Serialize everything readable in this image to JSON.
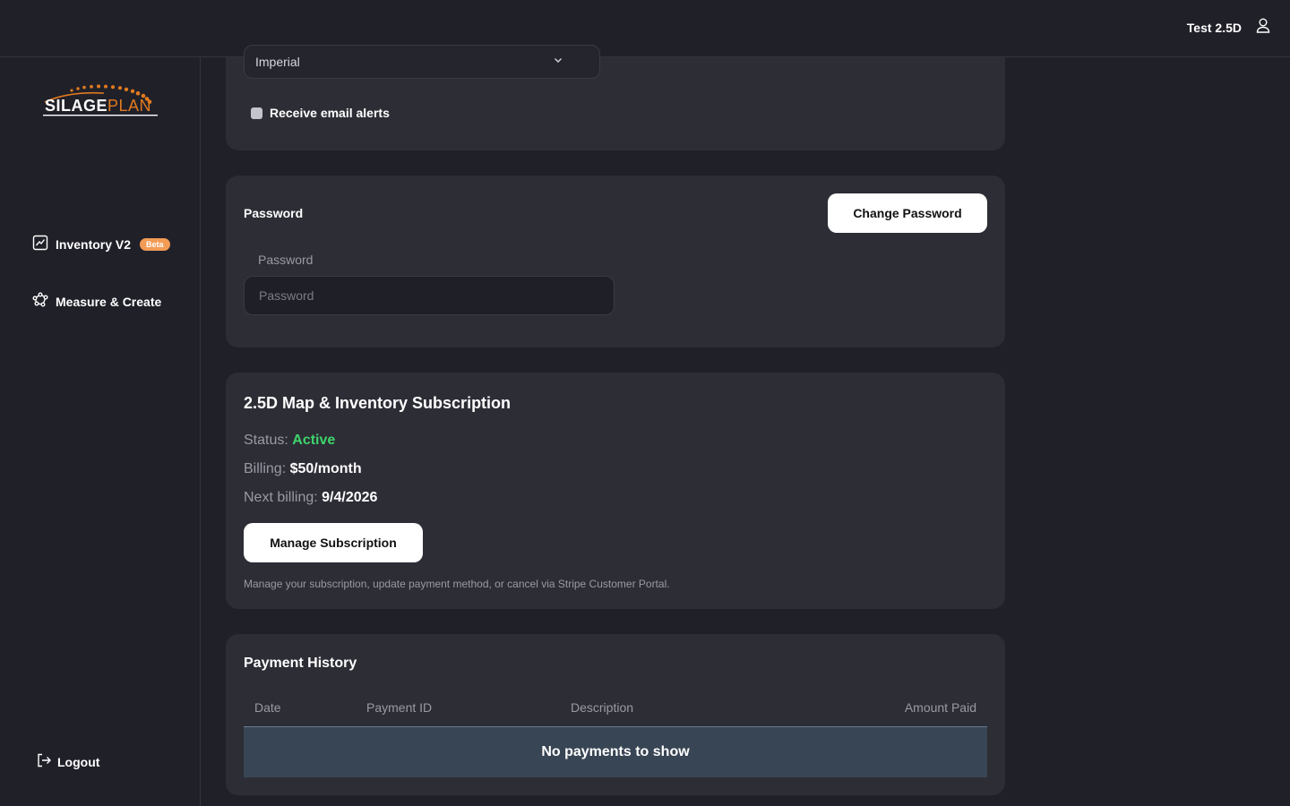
{
  "header": {
    "user_name": "Test 2.5D",
    "user_icon": "user-icon"
  },
  "sidebar": {
    "logo_text_left": "SILAGE",
    "logo_text_right": "PLAN",
    "items": [
      {
        "label": "Inventory V2",
        "icon": "chart-icon",
        "badge": "Beta"
      },
      {
        "label": "Measure & Create",
        "icon": "polygon-icon"
      }
    ],
    "logout_label": "Logout"
  },
  "preferences": {
    "units_value": "Imperial",
    "email_alerts_label": "Receive email alerts"
  },
  "password": {
    "title": "Password",
    "change_button": "Change Password",
    "field_label": "Password",
    "placeholder": "Password"
  },
  "subscription": {
    "title": "2.5D Map & Inventory Subscription",
    "status_label": "Status:",
    "status_value": "Active",
    "billing_label": "Billing:",
    "billing_value": "$50/month",
    "next_label": "Next billing:",
    "next_value": "9/4/2026",
    "manage_button": "Manage Subscription",
    "hint": "Manage your subscription, update payment method, or cancel via Stripe Customer Portal."
  },
  "payments": {
    "title": "Payment History",
    "columns": [
      "Date",
      "Payment ID",
      "Description",
      "Amount Paid"
    ],
    "empty_text": "No payments to show"
  },
  "colors": {
    "background": "#202029",
    "card": "#2d2d36",
    "accent_orange": "#f29b55",
    "status_active": "#3ed46a",
    "table_empty_row": "#384554"
  }
}
